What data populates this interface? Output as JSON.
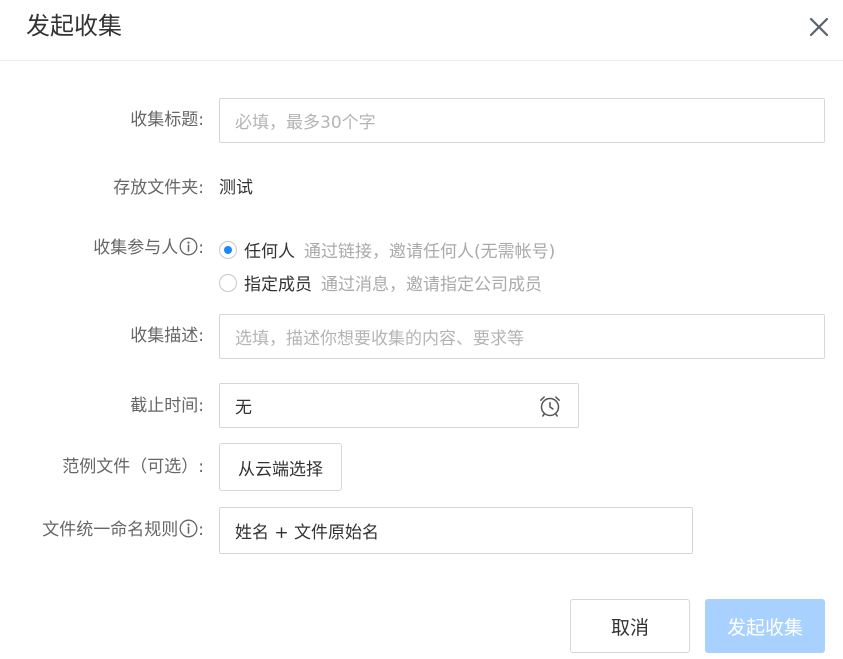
{
  "dialog": {
    "title": "发起收集"
  },
  "form": {
    "title_field": {
      "label": "收集标题:",
      "placeholder": "必填，最多30个字",
      "value": ""
    },
    "folder": {
      "label": "存放文件夹:",
      "value": "测试"
    },
    "participants": {
      "label": "收集参与人",
      "options": [
        {
          "label": "任何人",
          "hint": "通过链接，邀请任何人(无需帐号)",
          "checked": true
        },
        {
          "label": "指定成员",
          "hint": "通过消息，邀请指定公司成员",
          "checked": false
        }
      ]
    },
    "description": {
      "label": "收集描述:",
      "placeholder": "选填，描述你想要收集的内容、要求等"
    },
    "deadline": {
      "label": "截止时间:",
      "value": "无"
    },
    "sample_file": {
      "label": "范例文件（可选）:",
      "button": "从云端选择"
    },
    "naming_rule": {
      "label": "文件统一命名规则",
      "value": "姓名 + 文件原始名"
    }
  },
  "footer": {
    "cancel": "取消",
    "submit": "发起收集"
  },
  "colors": {
    "accent": "#1a88ff",
    "primary_disabled": "#a9d1ff"
  }
}
